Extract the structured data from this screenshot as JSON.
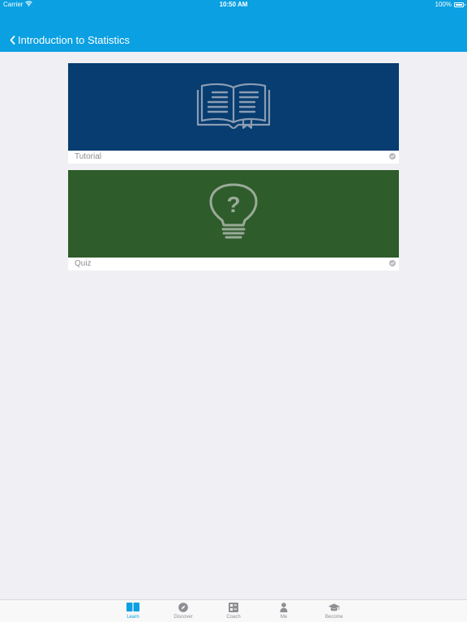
{
  "status_bar": {
    "carrier": "Carrier",
    "time": "10:50 AM",
    "battery": "100%",
    "battery_level": 1.0
  },
  "nav": {
    "title": "Introduction to Statistics"
  },
  "cards": [
    {
      "label": "Tutorial",
      "icon": "open-book-icon",
      "background": "#073d70",
      "completed": true
    },
    {
      "label": "Quiz",
      "icon": "lightbulb-question-icon",
      "background": "#2e5c2b",
      "completed": true
    }
  ],
  "tabs": [
    {
      "label": "Learn",
      "icon": "learn-icon",
      "active": true
    },
    {
      "label": "Discover",
      "icon": "compass-icon",
      "active": false
    },
    {
      "label": "Coach",
      "icon": "coach-icon",
      "active": false
    },
    {
      "label": "Me",
      "icon": "person-icon",
      "active": false
    },
    {
      "label": "Become",
      "icon": "graduation-cap-icon",
      "active": false
    }
  ],
  "colors": {
    "accent": "#0aa0e2",
    "tab_inactive": "#8e8e93",
    "background": "#efeff4"
  }
}
